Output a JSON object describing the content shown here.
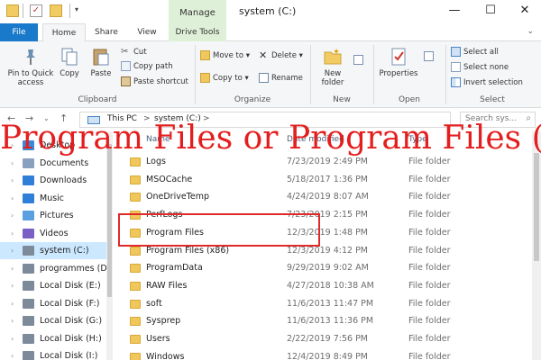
{
  "window": {
    "title": "system (C:)",
    "context_tab": "Manage",
    "controls": {
      "minimize": "—",
      "maximize": "☐",
      "close": "✕"
    }
  },
  "tabs": [
    "File",
    "Home",
    "Share",
    "View",
    "Drive Tools"
  ],
  "ribbon": {
    "clipboard": {
      "pin": "Pin to Quick access",
      "copy": "Copy",
      "paste": "Paste",
      "cut": "Cut",
      "copy_path": "Copy path",
      "paste_shortcut": "Paste shortcut",
      "label": "Clipboard"
    },
    "organize": {
      "move_to": "Move to",
      "copy_to": "Copy to",
      "delete": "Delete",
      "rename": "Rename",
      "label": "Organize"
    },
    "new": {
      "new_folder": "New folder",
      "label": "New"
    },
    "open": {
      "properties": "Properties",
      "label": "Open"
    },
    "select": {
      "select_all": "Select all",
      "select_none": "Select none",
      "invert": "Invert selection",
      "label": "Select"
    }
  },
  "address": {
    "this_pc": "This PC",
    "drive": "system (C:)",
    "sep": ">",
    "search_placeholder": "Search sys..."
  },
  "columns": {
    "name": "Name",
    "date": "Date modified",
    "type": "Type"
  },
  "nav_items": [
    {
      "label": "Desktop",
      "icon": "desktop-icon"
    },
    {
      "label": "Documents",
      "icon": "documents-icon"
    },
    {
      "label": "Downloads",
      "icon": "downloads-icon"
    },
    {
      "label": "Music",
      "icon": "music-icon"
    },
    {
      "label": "Pictures",
      "icon": "pictures-icon"
    },
    {
      "label": "Videos",
      "icon": "videos-icon"
    },
    {
      "label": "system (C:)",
      "icon": "drive-icon"
    },
    {
      "label": "programmes (D:",
      "icon": "drive-icon"
    },
    {
      "label": "Local Disk (E:)",
      "icon": "drive-icon"
    },
    {
      "label": "Local Disk (F:)",
      "icon": "drive-icon"
    },
    {
      "label": "Local Disk (G:)",
      "icon": "drive-icon"
    },
    {
      "label": "Local Disk (H:)",
      "icon": "drive-icon"
    },
    {
      "label": "Local Disk (I:)",
      "icon": "drive-icon"
    }
  ],
  "files": [
    {
      "name": "Logs",
      "date": "7/23/2019 2:49 PM",
      "type": "File folder"
    },
    {
      "name": "MSOCache",
      "date": "5/18/2017 1:36 PM",
      "type": "File folder"
    },
    {
      "name": "OneDriveTemp",
      "date": "4/24/2019 8:07 AM",
      "type": "File folder"
    },
    {
      "name": "PerfLogs",
      "date": "7/23/2019 2:15 PM",
      "type": "File folder"
    },
    {
      "name": "Program Files",
      "date": "12/3/2019 1:48 PM",
      "type": "File folder"
    },
    {
      "name": "Program Files (x86)",
      "date": "12/3/2019 4:12 PM",
      "type": "File folder"
    },
    {
      "name": "ProgramData",
      "date": "9/29/2019 9:02 AM",
      "type": "File folder"
    },
    {
      "name": "RAW Files",
      "date": "4/27/2018 10:38 AM",
      "type": "File folder"
    },
    {
      "name": "soft",
      "date": "11/6/2013 11:47 PM",
      "type": "File folder"
    },
    {
      "name": "Sysprep",
      "date": "11/6/2013 11:36 PM",
      "type": "File folder"
    },
    {
      "name": "Users",
      "date": "2/22/2019 7:56 PM",
      "type": "File folder"
    },
    {
      "name": "Windows",
      "date": "12/4/2019 8:49 PM",
      "type": "File folder"
    }
  ],
  "overlay_text": "Program Files or Program Files (x86)?",
  "colors": {
    "accent": "#1979ca",
    "manage": "#dff0d8",
    "overlay": "#e41e1e",
    "folder": "#f0c75a"
  }
}
